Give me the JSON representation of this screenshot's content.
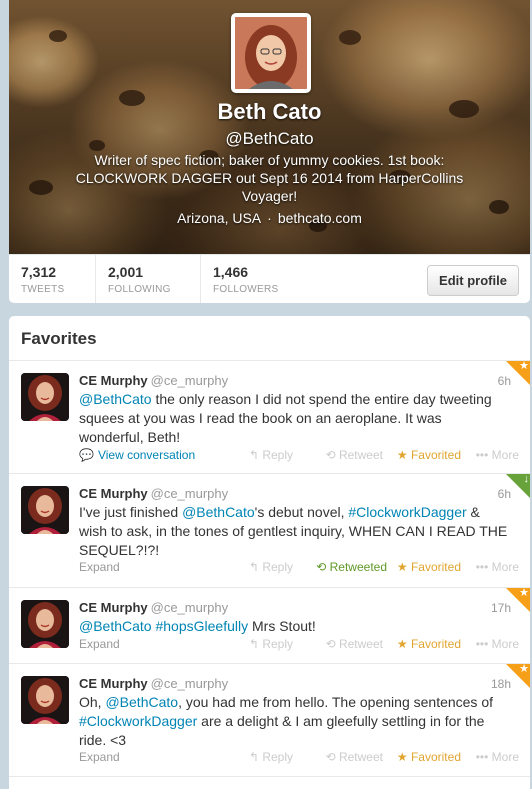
{
  "profile": {
    "name": "Beth Cato",
    "screen_name": "@BethCato",
    "bio": "Writer of spec fiction; baker of yummy cookies. 1st book: CLOCKWORK DAGGER out Sept 16 2014 from HarperCollins Voyager!",
    "location": "Arizona, USA",
    "separator": "·",
    "url": "bethcato.com",
    "edit_label": "Edit profile"
  },
  "stats": [
    {
      "value": "7,312",
      "label": "TWEETS"
    },
    {
      "value": "2,001",
      "label": "FOLLOWING"
    },
    {
      "value": "1,466",
      "label": "FOLLOWERS"
    }
  ],
  "favorites_title": "Favorites",
  "tweets": [
    {
      "name": "CE Murphy",
      "handle": "@ce_murphy",
      "time": "6h",
      "text_parts": [
        "@BethCato",
        " the only reason I did not spend the entire day tweeting squees at you was I read the book on an aeroplane. It was wonderful, Beth!"
      ],
      "footer_link": "View conversation",
      "reply": "Reply",
      "retweet": "Retweet",
      "favorite": "Favorited",
      "more": "More",
      "corner_color": "#f6a01a"
    },
    {
      "name": "CE Murphy",
      "handle": "@ce_murphy",
      "time": "6h",
      "text_parts": [
        "I've just finished ",
        "@BethCato",
        "'s debut novel, ",
        "#ClockworkDagger",
        " & wish to ask, in the tones of gentlest inquiry, WHEN CAN I READ THE SEQUEL?!?!"
      ],
      "footer_link": "Expand",
      "reply": "Reply",
      "retweet": "Retweeted",
      "favorite": "Favorited",
      "more": "More",
      "corner_color": "#68a23a"
    },
    {
      "name": "CE Murphy",
      "handle": "@ce_murphy",
      "time": "17h",
      "text_parts": [
        "@BethCato",
        " ",
        "#hopsGleefully",
        " Mrs Stout!"
      ],
      "footer_link": "Expand",
      "reply": "Reply",
      "retweet": "Retweet",
      "favorite": "Favorited",
      "more": "More",
      "corner_color": "#f6a01a"
    },
    {
      "name": "CE Murphy",
      "handle": "@ce_murphy",
      "time": "18h",
      "text_parts": [
        "Oh, ",
        "@BethCato",
        ", you had me from hello. The opening sentences of ",
        "#ClockworkDagger",
        " are a delight & I am gleefully settling in for the ride. <3"
      ],
      "footer_link": "Expand",
      "reply": "Reply",
      "retweet": "Retweet",
      "favorite": "Favorited",
      "more": "More",
      "corner_color": "#f6a01a"
    }
  ],
  "colors": {
    "link": "#0084b4",
    "favorited": "#e1a530",
    "retweeted": "#609928"
  }
}
